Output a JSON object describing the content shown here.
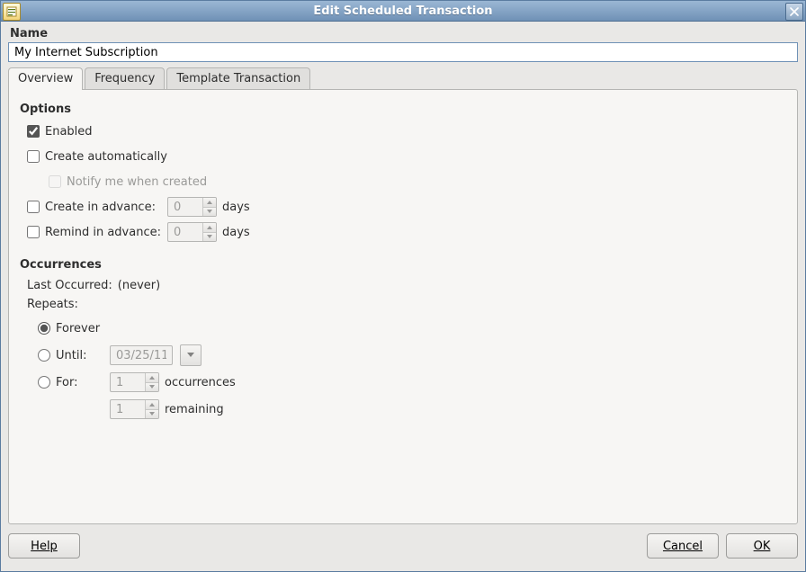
{
  "window": {
    "title": "Edit Scheduled Transaction"
  },
  "name": {
    "label": "Name",
    "value": "My Internet Subscription"
  },
  "tabs": {
    "overview": "Overview",
    "frequency": "Frequency",
    "template": "Template Transaction"
  },
  "options": {
    "heading": "Options",
    "enabled": "Enabled",
    "create_auto": "Create automatically",
    "notify": "Notify me when created",
    "create_advance": "Create in advance:",
    "remind_advance": "Remind in advance:",
    "days_suffix": "days",
    "create_days": "0",
    "remind_days": "0"
  },
  "occurrences": {
    "heading": "Occurrences",
    "last_label": "Last Occurred: ",
    "last_value": "(never)",
    "repeats": "Repeats:",
    "forever": "Forever",
    "until": "Until:",
    "until_date": "03/25/11",
    "for": "For:",
    "for_count": "1",
    "for_suffix": "occurrences",
    "remaining_count": "1",
    "remaining_suffix": "remaining"
  },
  "buttons": {
    "help": "Help",
    "cancel": "Cancel",
    "ok": "OK"
  }
}
